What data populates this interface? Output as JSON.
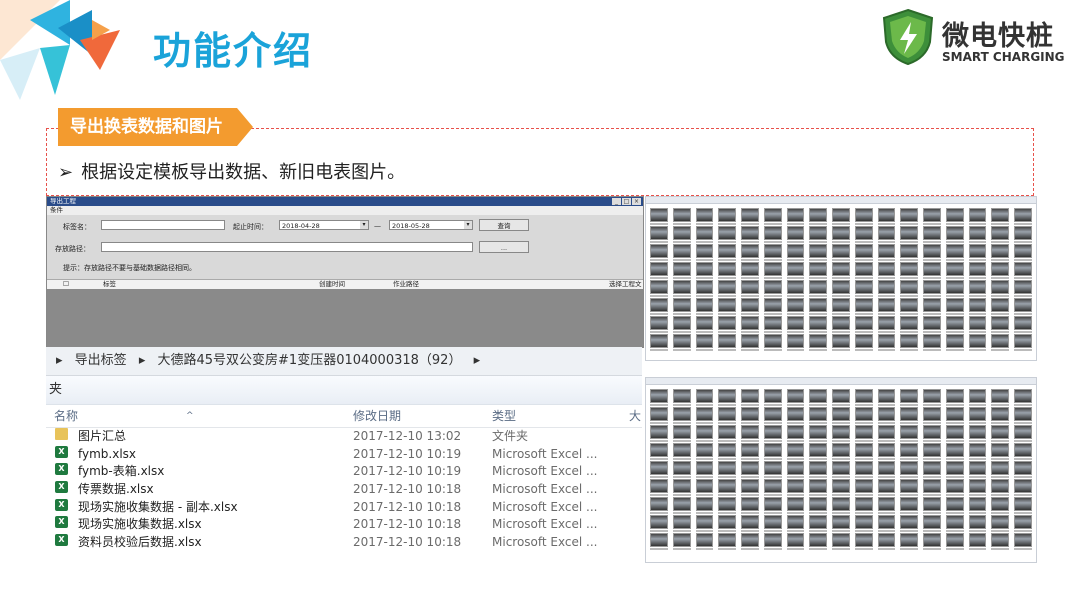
{
  "header": {
    "title": "功能介绍",
    "logo_cn": "微电快桩",
    "logo_en": "SMART CHARGING"
  },
  "section": {
    "tag": "导出换表数据和图片",
    "bullet": "根据设定模板导出数据、新旧电表图片。"
  },
  "export_window": {
    "title": "导出工程",
    "menu": "条件",
    "tag_label": "标签名：",
    "time_label": "起止时间：",
    "date_start": "2018-04-28",
    "date_sep": "—",
    "date_end": "2018-05-28",
    "query_button": "查询",
    "path_label": "存放路径：",
    "browse_button": "...",
    "hint": "提示：存放路径不要与基础数据路径相同。",
    "columns": [
      "标签",
      "创建时间",
      "作业路径",
      "选择工程文"
    ]
  },
  "explorer": {
    "breadcrumb": [
      "导出标签",
      "大德路45号双公变房#1变压器0104000318（92）"
    ],
    "folder_label": "夹",
    "columns": [
      "名称",
      "修改日期",
      "类型",
      "大"
    ],
    "files": [
      {
        "name": "图片汇总",
        "date": "2017-12-10 13:02",
        "type": "文件夹",
        "icon": "folder-icon"
      },
      {
        "name": "fymb.xlsx",
        "date": "2017-12-10 10:19",
        "type": "Microsoft Excel ...",
        "icon": "excel-icon"
      },
      {
        "name": "fymb-表箱.xlsx",
        "date": "2017-12-10 10:19",
        "type": "Microsoft Excel ...",
        "icon": "excel-icon"
      },
      {
        "name": "传票数据.xlsx",
        "date": "2017-12-10 10:18",
        "type": "Microsoft Excel ...",
        "icon": "excel-icon"
      },
      {
        "name": "现场实施收集数据 - 副本.xlsx",
        "date": "2017-12-10 10:18",
        "type": "Microsoft Excel ...",
        "icon": "excel-icon"
      },
      {
        "name": "现场实施收集数据.xlsx",
        "date": "2017-12-10 10:18",
        "type": "Microsoft Excel ...",
        "icon": "excel-icon"
      },
      {
        "name": "资料员校验后数据.xlsx",
        "date": "2017-12-10 10:18",
        "type": "Microsoft Excel ...",
        "icon": "excel-icon"
      }
    ]
  },
  "colors": {
    "title": "#1aa3d9",
    "tag_bg": "#f39b2f",
    "dash_border": "#e8514a",
    "logo_green": "#3d8f3a"
  }
}
